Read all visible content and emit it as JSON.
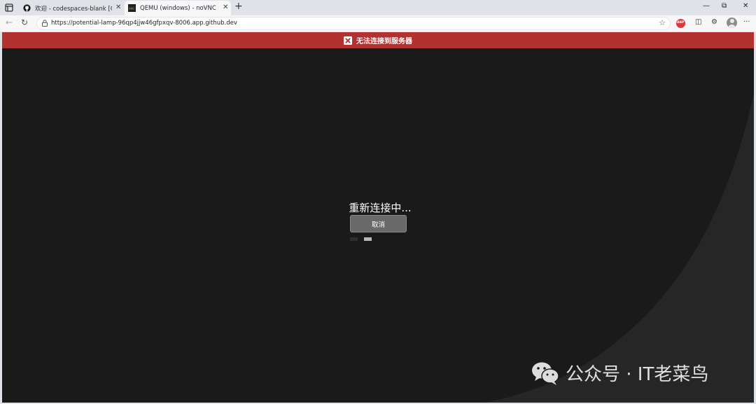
{
  "tabs": [
    {
      "title": "欢迎 - codespaces-blank [Codesp",
      "active": false,
      "favicon": "github-icon"
    },
    {
      "title": "QEMU (windows) - noVNC",
      "active": true,
      "favicon": "novnc-icon"
    }
  ],
  "window_controls": {
    "minimize": "—",
    "restore": "⧉",
    "close": "✕"
  },
  "toolbar": {
    "back": "←",
    "reload": "↻",
    "url": "https://potential-lamp-96qp4jjw46gfpxqv-8006.app.github.dev",
    "favorite": "☆",
    "abp_label": "ABP",
    "split_screen": "◫",
    "extensions": "⚙",
    "more": "···"
  },
  "novnc": {
    "status_message": "无法连接到服务器",
    "reconnecting_text": "重新连接中...",
    "cancel_label": "取消"
  },
  "watermark": {
    "text": "公众号 · IT老菜鸟"
  },
  "colors": {
    "status_bar": "#b23131",
    "background": "#1a1a1a",
    "accent_bg": "#2a2a2a"
  }
}
